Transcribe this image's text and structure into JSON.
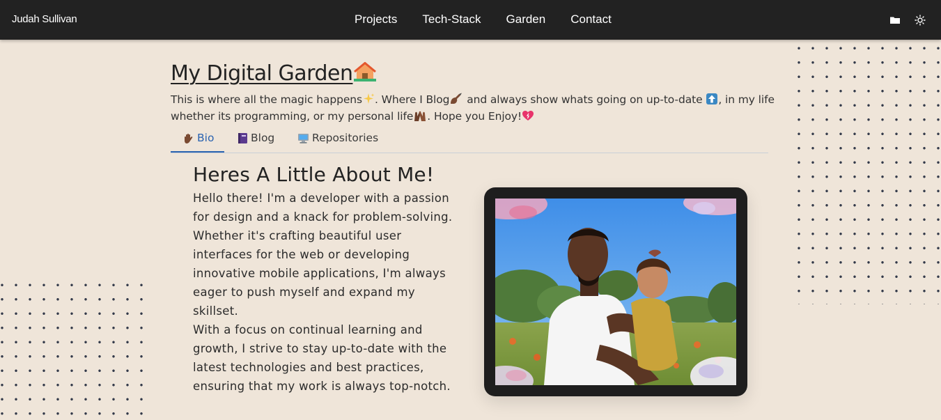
{
  "nav": {
    "brand": "Judah Sullivan",
    "links": [
      "Projects",
      "Tech-Stack",
      "Garden",
      "Contact"
    ],
    "icons": [
      "folder-icon",
      "sun-icon"
    ]
  },
  "garden": {
    "title": "My Digital Garden",
    "intro_1": "This is where all the magic happens",
    "intro_2": ". Where I Blog",
    "intro_3": " and always show whats going on up-to-date ",
    "intro_4": ", in my life whether its programming, or my personal life",
    "intro_5": ". Hope you Enjoy!"
  },
  "tabs": [
    {
      "label": "Bio",
      "icon": "hand-icon",
      "active": true
    },
    {
      "label": "Blog",
      "icon": "book-icon",
      "active": false
    },
    {
      "label": "Repositories",
      "icon": "computer-icon",
      "active": false
    }
  ],
  "about": {
    "heading": "Heres A Little About Me!",
    "lines": [
      "Hello there! I'm a developer with a passion",
      "for design and a knack for problem-solving.",
      "Whether it's crafting beautiful user",
      "interfaces for the web or developing",
      "innovative mobile applications, I'm always",
      "eager to push myself and expand my skillset.",
      "With a focus on continual learning and",
      "growth, I strive to stay up-to-date with the",
      "latest technologies and best practices,",
      "ensuring that my work is always top-notch."
    ]
  },
  "colors": {
    "background": "#efe5d9",
    "navbar": "#222222",
    "accent": "#2a63b0"
  }
}
